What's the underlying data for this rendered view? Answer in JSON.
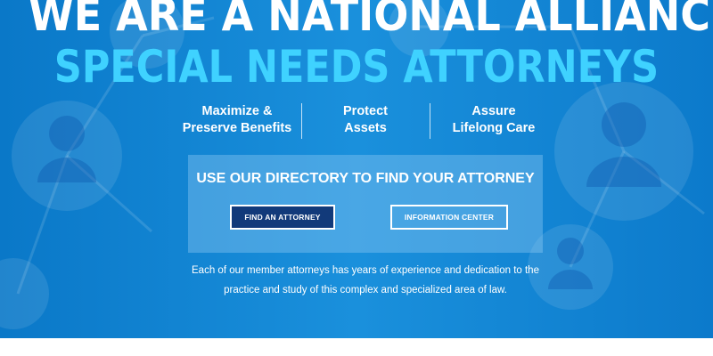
{
  "hero": {
    "title_line_1": "WE ARE A NATIONAL ALLIANCE OF",
    "title_line_2": "SPECIAL NEEDS ATTORNEYS",
    "background_icons": "people-network-icon",
    "colors": {
      "hero_blue": "#1a90dc",
      "accent_cyan": "#3fd2ff",
      "button_navy": "#123a7a"
    }
  },
  "pillars": [
    {
      "line_1": "Maximize &",
      "line_2": "Preserve Benefits"
    },
    {
      "line_1": "Protect",
      "line_2": "Assets"
    },
    {
      "line_1": "Assure",
      "line_2": "Lifelong Care"
    }
  ],
  "directory": {
    "heading": "USE OUR DIRECTORY TO FIND YOUR ATTORNEY",
    "find_button": "FIND AN ATTORNEY",
    "info_button": "INFORMATION CENTER"
  },
  "description": {
    "line_1": "Each of our member attorneys has years of experience and dedication to the",
    "line_2": "practice and study of this complex and specialized area of law."
  }
}
